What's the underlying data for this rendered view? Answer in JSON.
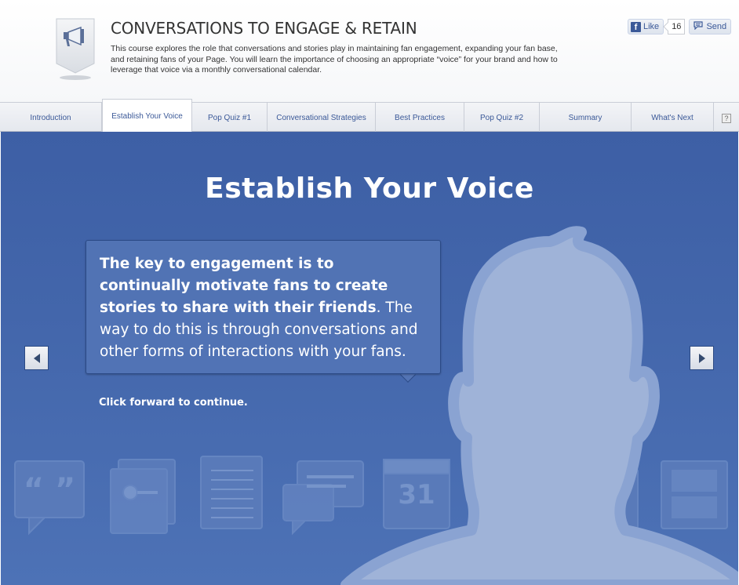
{
  "header": {
    "title": "CONVERSATIONS TO ENGAGE & RETAIN",
    "description": "This course explores the role that conversations and stories play in maintaining fan engagement, expanding your fan base, and retaining fans of your Page. You will learn the importance of choosing an appropriate “voice” for your brand and how to leverage that voice via a monthly conversational calendar.",
    "icon": "megaphone-icon"
  },
  "social": {
    "like_label": "Like",
    "like_count": "16",
    "send_label": "Send",
    "brand_color": "#3b5998"
  },
  "tabs": [
    {
      "label": "Introduction",
      "active": false
    },
    {
      "label": "Establish Your Voice",
      "active": true
    },
    {
      "label": "Pop Quiz #1",
      "active": false
    },
    {
      "label": "Conversational Strategies",
      "active": false
    },
    {
      "label": "Best Practices",
      "active": false
    },
    {
      "label": "Pop Quiz #2",
      "active": false
    },
    {
      "label": "Summary",
      "active": false
    },
    {
      "label": "What's Next",
      "active": false
    }
  ],
  "help_label": "?",
  "slide": {
    "title": "Establish Your Voice",
    "bubble_bold": "The key to engagement is to continually motivate fans to create stories to share with their friends",
    "bubble_rest": ". The way to do this is through conversations and other forms of interactions with your fans.",
    "continue_text": "Click forward to continue.",
    "background_color": "#4366ab",
    "calendar_day": "31"
  }
}
